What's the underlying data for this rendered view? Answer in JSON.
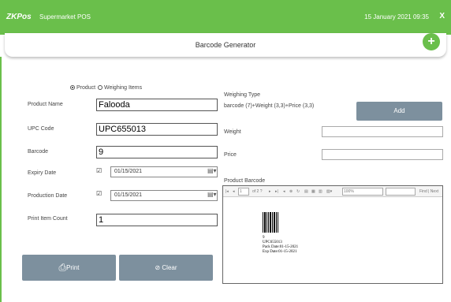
{
  "topbar": {
    "logo": "ZKPos",
    "app_name": "Supermarket POS",
    "datetime": "15 January 2021 09:35",
    "close": "X",
    "bg_color": "#6abf4b"
  },
  "header": {
    "title": "Barcode Generator",
    "add_symbol": "+"
  },
  "item_type": {
    "options": [
      "Product",
      "Weighing Items"
    ],
    "selected": "Product"
  },
  "form": {
    "product_name": {
      "label": "Product Name",
      "value": "Falooda"
    },
    "upc_code": {
      "label": "UPC Code",
      "value": "UPC655013"
    },
    "barcode": {
      "label": "Barcode",
      "value": "9"
    },
    "expiry_date": {
      "label": "Expiry Date",
      "checked": true,
      "value": "01/15/2021"
    },
    "production_date": {
      "label": "Production Date",
      "checked": true,
      "value": "01/15/2021"
    },
    "print_item_count": {
      "label": "Print Item Count",
      "value": "1"
    }
  },
  "weighing": {
    "type_label": "Weighing Type",
    "type_value": "barcode (7)+Weight (3,3)+Price (3,3)",
    "add_label": "Add",
    "weight_label": "Weight",
    "price_label": "Price"
  },
  "product_barcode": {
    "label": "Product Barcode",
    "toolbar": {
      "page_current": "1",
      "page_of": "of 2 ?",
      "zoom": "100%",
      "find_next": "Find | Next"
    },
    "print_lines": [
      "9",
      "UPC655013",
      "Pack Date:01-15-2021",
      "Exp Date:01-15-2021"
    ]
  },
  "actions": {
    "print_label": "Print",
    "clear_label": "Clear"
  },
  "colors": {
    "accent": "#6abf4b",
    "button": "#7d909e"
  }
}
